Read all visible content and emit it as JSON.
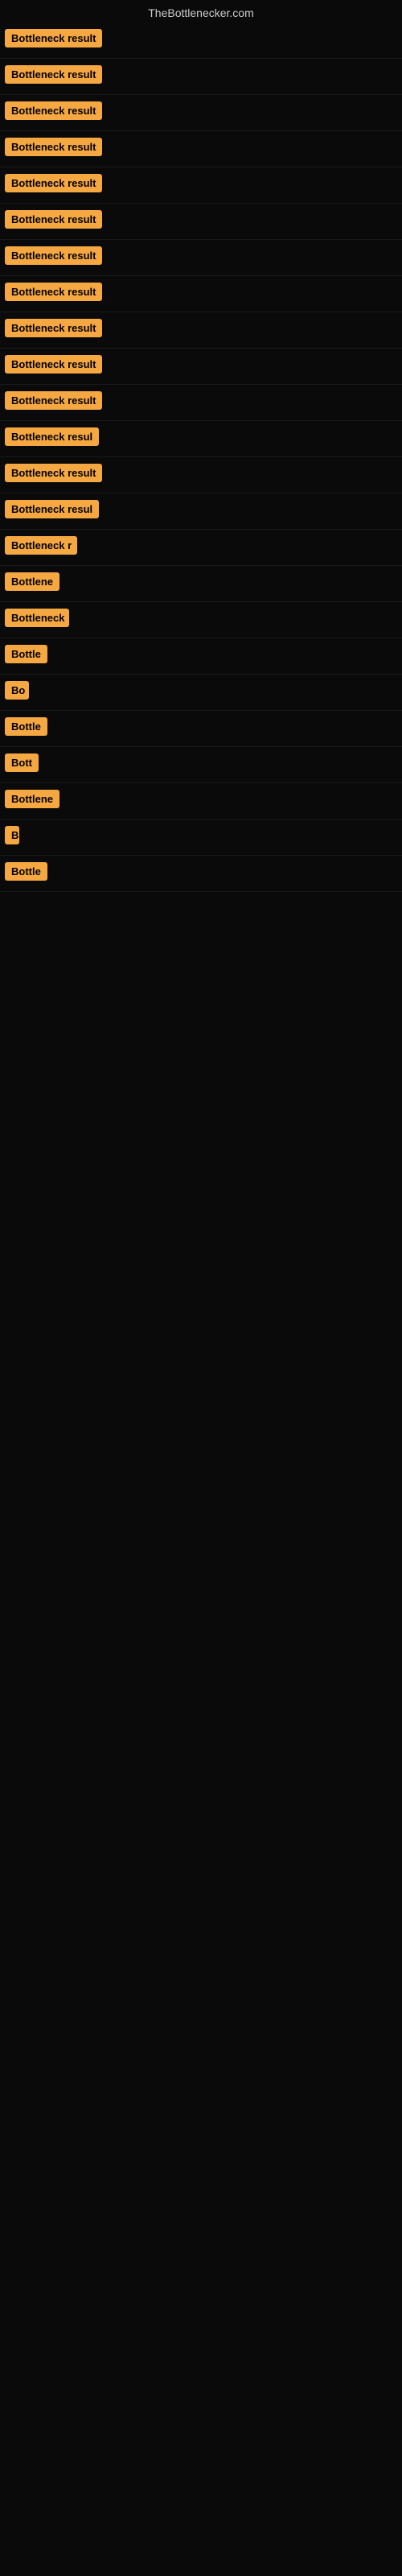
{
  "site": {
    "title": "TheBottlenecker.com"
  },
  "results": [
    {
      "id": 1,
      "label": "Bottleneck result",
      "width": 130
    },
    {
      "id": 2,
      "label": "Bottleneck result",
      "width": 130
    },
    {
      "id": 3,
      "label": "Bottleneck result",
      "width": 130
    },
    {
      "id": 4,
      "label": "Bottleneck result",
      "width": 130
    },
    {
      "id": 5,
      "label": "Bottleneck result",
      "width": 130
    },
    {
      "id": 6,
      "label": "Bottleneck result",
      "width": 130
    },
    {
      "id": 7,
      "label": "Bottleneck result",
      "width": 130
    },
    {
      "id": 8,
      "label": "Bottleneck result",
      "width": 130
    },
    {
      "id": 9,
      "label": "Bottleneck result",
      "width": 130
    },
    {
      "id": 10,
      "label": "Bottleneck result",
      "width": 130
    },
    {
      "id": 11,
      "label": "Bottleneck result",
      "width": 130
    },
    {
      "id": 12,
      "label": "Bottleneck resul",
      "width": 120
    },
    {
      "id": 13,
      "label": "Bottleneck result",
      "width": 130
    },
    {
      "id": 14,
      "label": "Bottleneck resul",
      "width": 118
    },
    {
      "id": 15,
      "label": "Bottleneck r",
      "width": 90
    },
    {
      "id": 16,
      "label": "Bottlene",
      "width": 74
    },
    {
      "id": 17,
      "label": "Bottleneck",
      "width": 80
    },
    {
      "id": 18,
      "label": "Bottle",
      "width": 58
    },
    {
      "id": 19,
      "label": "Bo",
      "width": 30
    },
    {
      "id": 20,
      "label": "Bottle",
      "width": 58
    },
    {
      "id": 21,
      "label": "Bott",
      "width": 44
    },
    {
      "id": 22,
      "label": "Bottlene",
      "width": 72
    },
    {
      "id": 23,
      "label": "B",
      "width": 18
    },
    {
      "id": 24,
      "label": "Bottle",
      "width": 58
    }
  ]
}
